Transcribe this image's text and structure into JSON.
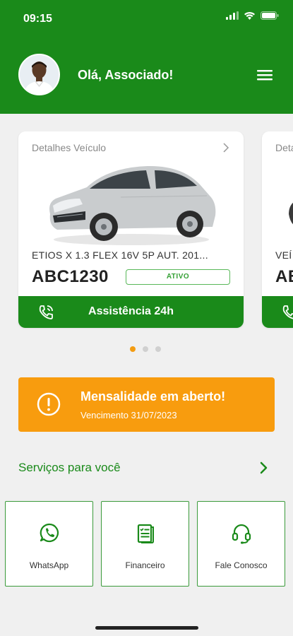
{
  "status_bar": {
    "time": "09:15"
  },
  "header": {
    "greeting": "Olá, Associado!"
  },
  "vehicle_cards": [
    {
      "title": "Detalhes Veículo",
      "model": "ETIOS X 1.3 FLEX 16V 5P AUT. 201...",
      "plate": "ABC1230",
      "status": "ATIVO",
      "assist_label": "Assistência 24h"
    },
    {
      "title": "Deta",
      "model": "VEÍ",
      "plate": "AB"
    }
  ],
  "carousel": {
    "dots": 3,
    "active_index": 0
  },
  "alert": {
    "title": "Mensalidade em aberto!",
    "subtitle": "Vencimento 31/07/2023"
  },
  "services": {
    "title": "Serviços para você",
    "items": [
      {
        "label": "WhatsApp",
        "icon": "whatsapp-icon"
      },
      {
        "label": "Financeiro",
        "icon": "document-icon"
      },
      {
        "label": "Fale Conosco",
        "icon": "headset-icon"
      }
    ]
  },
  "colors": {
    "brand_green": "#1a8a1a",
    "alert_orange": "#f89c0e",
    "dot_active": "#f39c12",
    "background": "#f0f0f0"
  }
}
